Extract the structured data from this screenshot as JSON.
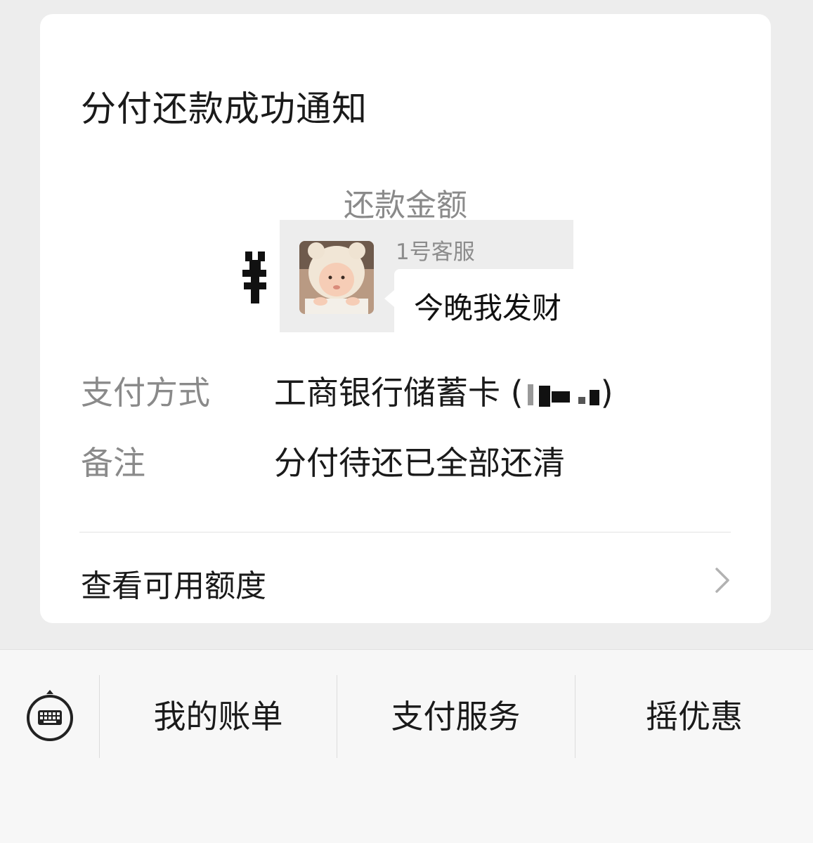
{
  "card": {
    "title": "分付还款成功通知",
    "amount_label": "还款金额",
    "amount_symbol": "¥",
    "rows": [
      {
        "label": "支付方式",
        "value": "工商银行储蓄卡 ("
      },
      {
        "label": "备注",
        "value": "分付待还已全部还清"
      }
    ],
    "card_value_close": ")",
    "link": {
      "label": "查看可用额度",
      "icon": "chevron-right-icon"
    }
  },
  "sticker": {
    "sender_name": "1号客服",
    "message": "今晚我发财",
    "avatar_icon": "baby-avatar"
  },
  "menu": {
    "keyboard_icon": "keyboard-icon",
    "items": [
      {
        "label": "我的账单"
      },
      {
        "label": "支付服务"
      },
      {
        "label": "摇优惠"
      }
    ]
  }
}
